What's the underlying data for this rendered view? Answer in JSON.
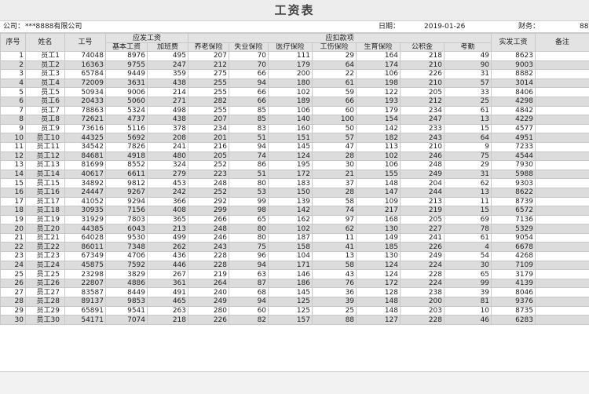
{
  "sheet": {
    "title": "工资表",
    "company_label": "公司：",
    "company_value": "***8888有限公司",
    "date_label": "日期：",
    "date_value": "2019-01-26",
    "finance_label": "财务：",
    "finance_value": "88"
  },
  "headers": {
    "seq": "序号",
    "name": "姓名",
    "id": "工号",
    "payable": "应发工资",
    "base": "基本工资",
    "overtime": "加班费",
    "deductions": "应扣款项",
    "pension": "养老保险",
    "unemployment": "失业保险",
    "medical": "医疗保险",
    "injury": "工伤保险",
    "maternity": "生育保险",
    "fund": "公积金",
    "attendance": "考勤",
    "net": "实发工资",
    "remark": "备注"
  },
  "rows": [
    [
      "1",
      "员工1",
      "74048",
      "8976",
      "495",
      "207",
      "70",
      "111",
      "29",
      "164",
      "218",
      "49",
      "8623",
      ""
    ],
    [
      "2",
      "员工2",
      "16363",
      "9755",
      "247",
      "212",
      "70",
      "179",
      "64",
      "174",
      "210",
      "90",
      "9003",
      ""
    ],
    [
      "3",
      "员工3",
      "65784",
      "9449",
      "359",
      "275",
      "66",
      "200",
      "22",
      "106",
      "226",
      "31",
      "8882",
      ""
    ],
    [
      "4",
      "员工4",
      "72009",
      "3631",
      "438",
      "255",
      "94",
      "180",
      "61",
      "198",
      "210",
      "57",
      "3014",
      ""
    ],
    [
      "5",
      "员工5",
      "50934",
      "9006",
      "214",
      "255",
      "66",
      "102",
      "59",
      "122",
      "205",
      "33",
      "8406",
      ""
    ],
    [
      "6",
      "员工6",
      "20433",
      "5060",
      "271",
      "282",
      "66",
      "189",
      "66",
      "193",
      "212",
      "25",
      "4298",
      ""
    ],
    [
      "7",
      "员工7",
      "78863",
      "5324",
      "498",
      "255",
      "85",
      "106",
      "60",
      "179",
      "234",
      "61",
      "4842",
      ""
    ],
    [
      "8",
      "员工8",
      "72621",
      "4737",
      "438",
      "207",
      "85",
      "140",
      "100",
      "154",
      "247",
      "13",
      "4229",
      ""
    ],
    [
      "9",
      "员工9",
      "73616",
      "5116",
      "378",
      "234",
      "83",
      "160",
      "50",
      "142",
      "233",
      "15",
      "4577",
      ""
    ],
    [
      "10",
      "员工10",
      "44325",
      "5692",
      "208",
      "201",
      "51",
      "151",
      "57",
      "182",
      "243",
      "64",
      "4951",
      ""
    ],
    [
      "11",
      "员工11",
      "34542",
      "7826",
      "241",
      "216",
      "94",
      "145",
      "47",
      "113",
      "210",
      "9",
      "7233",
      ""
    ],
    [
      "12",
      "员工12",
      "84681",
      "4918",
      "480",
      "205",
      "74",
      "124",
      "28",
      "102",
      "246",
      "75",
      "4544",
      ""
    ],
    [
      "13",
      "员工13",
      "81699",
      "8552",
      "324",
      "252",
      "86",
      "195",
      "30",
      "106",
      "248",
      "29",
      "7930",
      ""
    ],
    [
      "14",
      "员工14",
      "40617",
      "6611",
      "279",
      "223",
      "51",
      "172",
      "21",
      "155",
      "249",
      "31",
      "5988",
      ""
    ],
    [
      "15",
      "员工15",
      "34892",
      "9812",
      "453",
      "248",
      "80",
      "183",
      "37",
      "148",
      "204",
      "62",
      "9303",
      ""
    ],
    [
      "16",
      "员工16",
      "24447",
      "9267",
      "242",
      "252",
      "53",
      "150",
      "28",
      "147",
      "244",
      "13",
      "8622",
      ""
    ],
    [
      "17",
      "员工17",
      "41052",
      "9294",
      "366",
      "292",
      "99",
      "139",
      "58",
      "109",
      "213",
      "11",
      "8739",
      ""
    ],
    [
      "18",
      "员工18",
      "30935",
      "7156",
      "408",
      "299",
      "98",
      "142",
      "74",
      "217",
      "219",
      "15",
      "6572",
      ""
    ],
    [
      "19",
      "员工19",
      "31929",
      "7803",
      "365",
      "266",
      "65",
      "162",
      "97",
      "168",
      "205",
      "69",
      "7136",
      ""
    ],
    [
      "20",
      "员工20",
      "44385",
      "6043",
      "213",
      "248",
      "80",
      "102",
      "62",
      "130",
      "227",
      "78",
      "5329",
      ""
    ],
    [
      "21",
      "员工21",
      "64028",
      "9530",
      "499",
      "246",
      "80",
      "187",
      "11",
      "149",
      "241",
      "61",
      "9054",
      ""
    ],
    [
      "22",
      "员工22",
      "86011",
      "7348",
      "262",
      "243",
      "75",
      "158",
      "41",
      "185",
      "226",
      "4",
      "6678",
      ""
    ],
    [
      "23",
      "员工23",
      "67349",
      "4706",
      "436",
      "228",
      "96",
      "104",
      "13",
      "130",
      "249",
      "54",
      "4268",
      ""
    ],
    [
      "24",
      "员工24",
      "45875",
      "7592",
      "446",
      "228",
      "94",
      "171",
      "58",
      "124",
      "224",
      "30",
      "7109",
      ""
    ],
    [
      "25",
      "员工25",
      "23298",
      "3829",
      "267",
      "219",
      "63",
      "146",
      "43",
      "124",
      "228",
      "65",
      "3179",
      ""
    ],
    [
      "26",
      "员工26",
      "22807",
      "4886",
      "361",
      "264",
      "87",
      "186",
      "76",
      "172",
      "224",
      "99",
      "4139",
      ""
    ],
    [
      "27",
      "员工27",
      "83587",
      "8449",
      "491",
      "240",
      "68",
      "145",
      "36",
      "128",
      "238",
      "39",
      "8046",
      ""
    ],
    [
      "28",
      "员工28",
      "89137",
      "9853",
      "465",
      "249",
      "94",
      "125",
      "39",
      "148",
      "200",
      "81",
      "9376",
      ""
    ],
    [
      "29",
      "员工29",
      "65891",
      "9541",
      "263",
      "280",
      "60",
      "125",
      "25",
      "148",
      "203",
      "10",
      "8735",
      ""
    ],
    [
      "30",
      "员工30",
      "54171",
      "7074",
      "218",
      "226",
      "82",
      "157",
      "88",
      "127",
      "228",
      "46",
      "6283",
      ""
    ]
  ]
}
